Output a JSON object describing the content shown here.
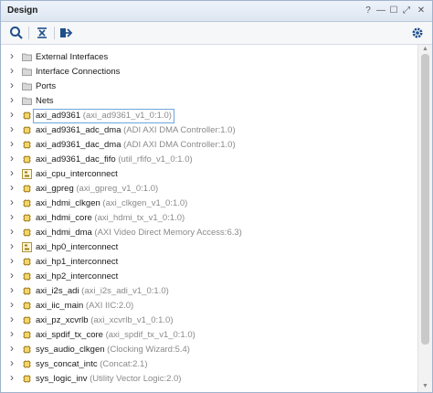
{
  "panel": {
    "title": "Design",
    "controls": [
      "?",
      "—",
      "☐",
      "⤢",
      "✕"
    ]
  },
  "toolbar": {
    "icons": [
      "search-icon",
      "collapse-all-icon",
      "expand-all-icon",
      "settings-icon"
    ]
  },
  "tree": {
    "items": [
      {
        "label": "External Interfaces",
        "sub": "",
        "icon": "folder-icon"
      },
      {
        "label": "Interface Connections",
        "sub": "",
        "icon": "folder-icon"
      },
      {
        "label": "Ports",
        "sub": "",
        "icon": "folder-icon"
      },
      {
        "label": "Nets",
        "sub": "",
        "icon": "folder-icon"
      },
      {
        "label": "axi_ad9361",
        "sub": " (axi_ad9361_v1_0:1.0)",
        "icon": "ip-block-icon",
        "selected": true
      },
      {
        "label": "axi_ad9361_adc_dma",
        "sub": " (ADI AXI DMA Controller:1.0)",
        "icon": "ip-block-icon"
      },
      {
        "label": "axi_ad9361_dac_dma",
        "sub": " (ADI AXI DMA Controller:1.0)",
        "icon": "ip-block-icon"
      },
      {
        "label": "axi_ad9361_dac_fifo",
        "sub": " (util_rfifo_v1_0:1.0)",
        "icon": "ip-block-icon"
      },
      {
        "label": "axi_cpu_interconnect",
        "sub": "",
        "icon": "hierarchy-icon"
      },
      {
        "label": "axi_gpreg",
        "sub": " (axi_gpreg_v1_0:1.0)",
        "icon": "ip-block-icon"
      },
      {
        "label": "axi_hdmi_clkgen",
        "sub": " (axi_clkgen_v1_0:1.0)",
        "icon": "ip-block-icon"
      },
      {
        "label": "axi_hdmi_core",
        "sub": " (axi_hdmi_tx_v1_0:1.0)",
        "icon": "ip-block-icon"
      },
      {
        "label": "axi_hdmi_dma",
        "sub": " (AXI Video Direct Memory Access:6.3)",
        "icon": "ip-block-icon"
      },
      {
        "label": "axi_hp0_interconnect",
        "sub": "",
        "icon": "hierarchy-icon"
      },
      {
        "label": "axi_hp1_interconnect",
        "sub": "",
        "icon": "ip-block-icon"
      },
      {
        "label": "axi_hp2_interconnect",
        "sub": "",
        "icon": "ip-block-icon"
      },
      {
        "label": "axi_i2s_adi",
        "sub": " (axi_i2s_adi_v1_0:1.0)",
        "icon": "ip-block-icon"
      },
      {
        "label": "axi_iic_main",
        "sub": " (AXI IIC:2.0)",
        "icon": "ip-block-icon"
      },
      {
        "label": "axi_pz_xcvrlb",
        "sub": " (axi_xcvrlb_v1_0:1.0)",
        "icon": "ip-block-icon"
      },
      {
        "label": "axi_spdif_tx_core",
        "sub": " (axi_spdif_tx_v1_0:1.0)",
        "icon": "ip-block-icon"
      },
      {
        "label": "sys_audio_clkgen",
        "sub": " (Clocking Wizard:5.4)",
        "icon": "ip-block-icon"
      },
      {
        "label": "sys_concat_intc",
        "sub": " (Concat:2.1)",
        "icon": "ip-block-icon"
      },
      {
        "label": "sys_logic_inv",
        "sub": " (Utility Vector Logic:2.0)",
        "icon": "ip-block-icon"
      }
    ]
  }
}
